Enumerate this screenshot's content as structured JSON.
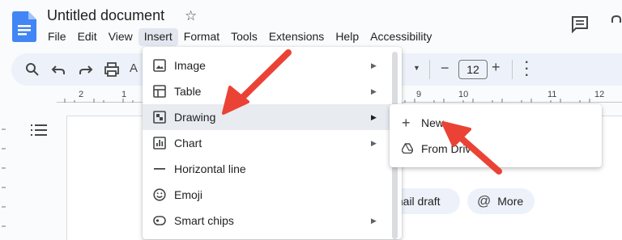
{
  "app": {
    "doc_title": "Untitled document"
  },
  "menubar": {
    "items": [
      "File",
      "Edit",
      "View",
      "Insert",
      "Format",
      "Tools",
      "Extensions",
      "Help",
      "Accessibility"
    ],
    "active": "Insert"
  },
  "toolbar": {
    "font_size": "12",
    "minus": "−",
    "plus": "+"
  },
  "ruler": {
    "labels": [
      "2",
      "1",
      "9",
      "10",
      "11",
      "12"
    ]
  },
  "insert_menu": {
    "items": [
      {
        "label": "Image",
        "icon": "image-icon",
        "submenu": true
      },
      {
        "label": "Table",
        "icon": "table-icon",
        "submenu": true
      },
      {
        "label": "Drawing",
        "icon": "drawing-icon",
        "submenu": true
      },
      {
        "label": "Chart",
        "icon": "chart-icon",
        "submenu": true
      },
      {
        "label": "Horizontal line",
        "icon": "horizontal-line-icon",
        "submenu": false
      },
      {
        "label": "Emoji",
        "icon": "emoji-icon",
        "submenu": false
      },
      {
        "label": "Smart chips",
        "icon": "smart-chips-icon",
        "submenu": true
      }
    ]
  },
  "drawing_submenu": {
    "items": [
      {
        "label": "New",
        "icon": "plus-icon"
      },
      {
        "label": "From Drive",
        "icon": "drive-icon"
      }
    ]
  },
  "chips": {
    "email_draft": "mail draft",
    "more": "More"
  },
  "colors": {
    "accent": "#1a73e8",
    "arrow": "#ea4335",
    "menu_highlight": "#e8ebf0"
  }
}
